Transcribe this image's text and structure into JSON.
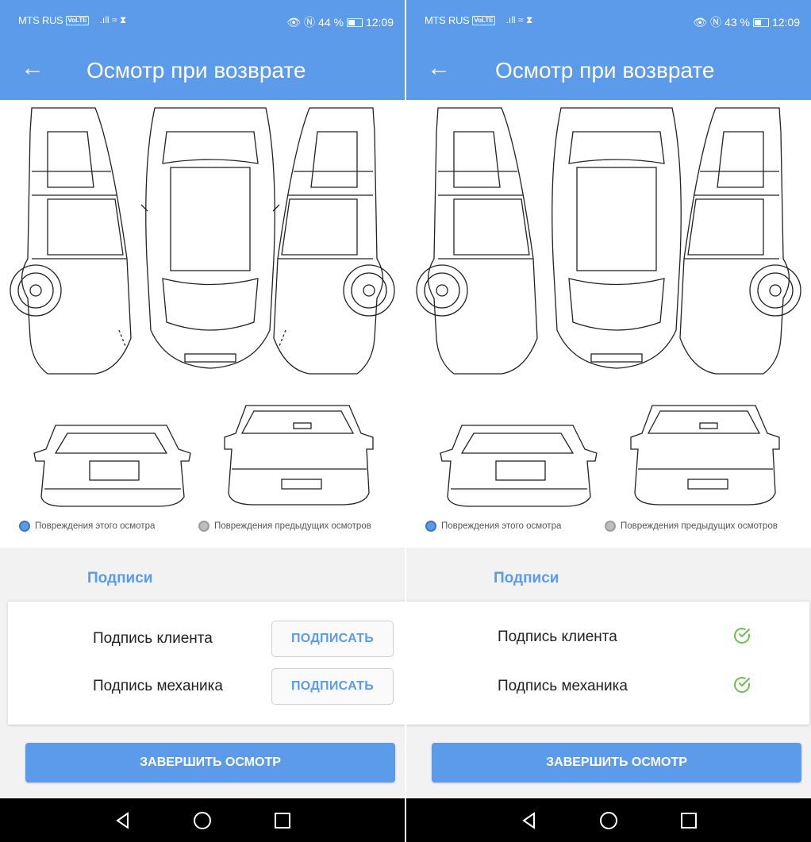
{
  "colors": {
    "accent": "#5b9bea",
    "check": "#6cc24a",
    "grey_dot": "#bdbdbd"
  },
  "statusbar_left": {
    "carrier": "MTS RUS",
    "volte": "VoLTE",
    "signal": ".ıll ≈ ⧗",
    "battery_pct": "44 %",
    "battery_level": 0.44,
    "time": "12:09"
  },
  "statusbar_right": {
    "carrier": "MTS RUS",
    "volte": "VoLTE",
    "signal": ".ıll ≈ ⧗",
    "battery_pct": "43 %",
    "battery_level": 0.43,
    "time": "12:09"
  },
  "appbar": {
    "back_icon": "arrow-back-icon",
    "title": "Осмотр при возврате"
  },
  "legend": {
    "current": "Повреждения этого осмотра",
    "previous": "Повреждения предыдущих осмотров"
  },
  "signatures": {
    "header": "Подписи",
    "client": "Подпись клиента",
    "mechanic": "Подпись механика",
    "sign_button": "ПОДПИСАТЬ"
  },
  "finish_button": "ЗАВЕРШИТЬ ОСМОТР",
  "navbar": {
    "back_icon": "triangle-back-icon",
    "home_icon": "circle-home-icon",
    "recents_icon": "square-recents-icon"
  }
}
